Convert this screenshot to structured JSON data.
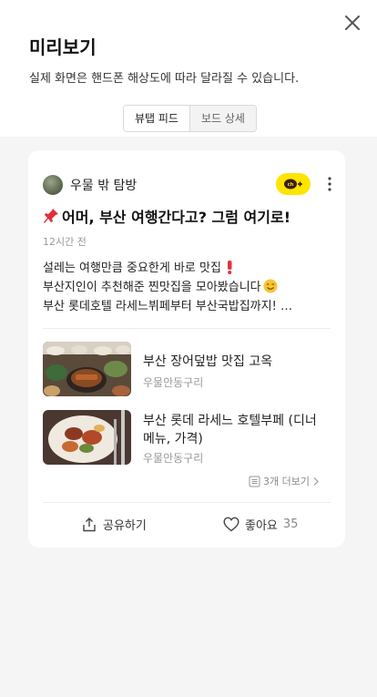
{
  "header": {
    "title": "미리보기",
    "subtitle": "실제 화면은 핸드폰 해상도에 따라 달라질 수 있습니다."
  },
  "tabs": [
    {
      "label": "뷰탭 피드",
      "active": true
    },
    {
      "label": "보드 상세",
      "active": false
    }
  ],
  "post": {
    "author": "우물 밖 탐방",
    "title": "어머, 부산 여행간다고? 그럼 여기로!",
    "timestamp": "12시간 전",
    "body_lines": [
      "설레는 여행만큼 중요한게 바로 맛집",
      "부산지인이 추천해준 찐맛집을 모아봤습니다",
      "부산 롯데호텔 라세느뷔페부터 부산국밥집까지! …"
    ],
    "items": [
      {
        "title": "부산 장어덮밥 맛집 고옥",
        "source": "우물안동구리"
      },
      {
        "title": "부산 롯데 라세느 호텔부페 (디너 메뉴, 가격)",
        "source": "우물안동구리"
      }
    ],
    "more_label": "3개 더보기",
    "share_label": "공유하기",
    "like_label": "좋아요",
    "like_count": "35"
  },
  "colors": {
    "kakao_yellow": "#fee500",
    "heart_emoji": "#e8303a",
    "smile_emoji": "#f7c531"
  }
}
